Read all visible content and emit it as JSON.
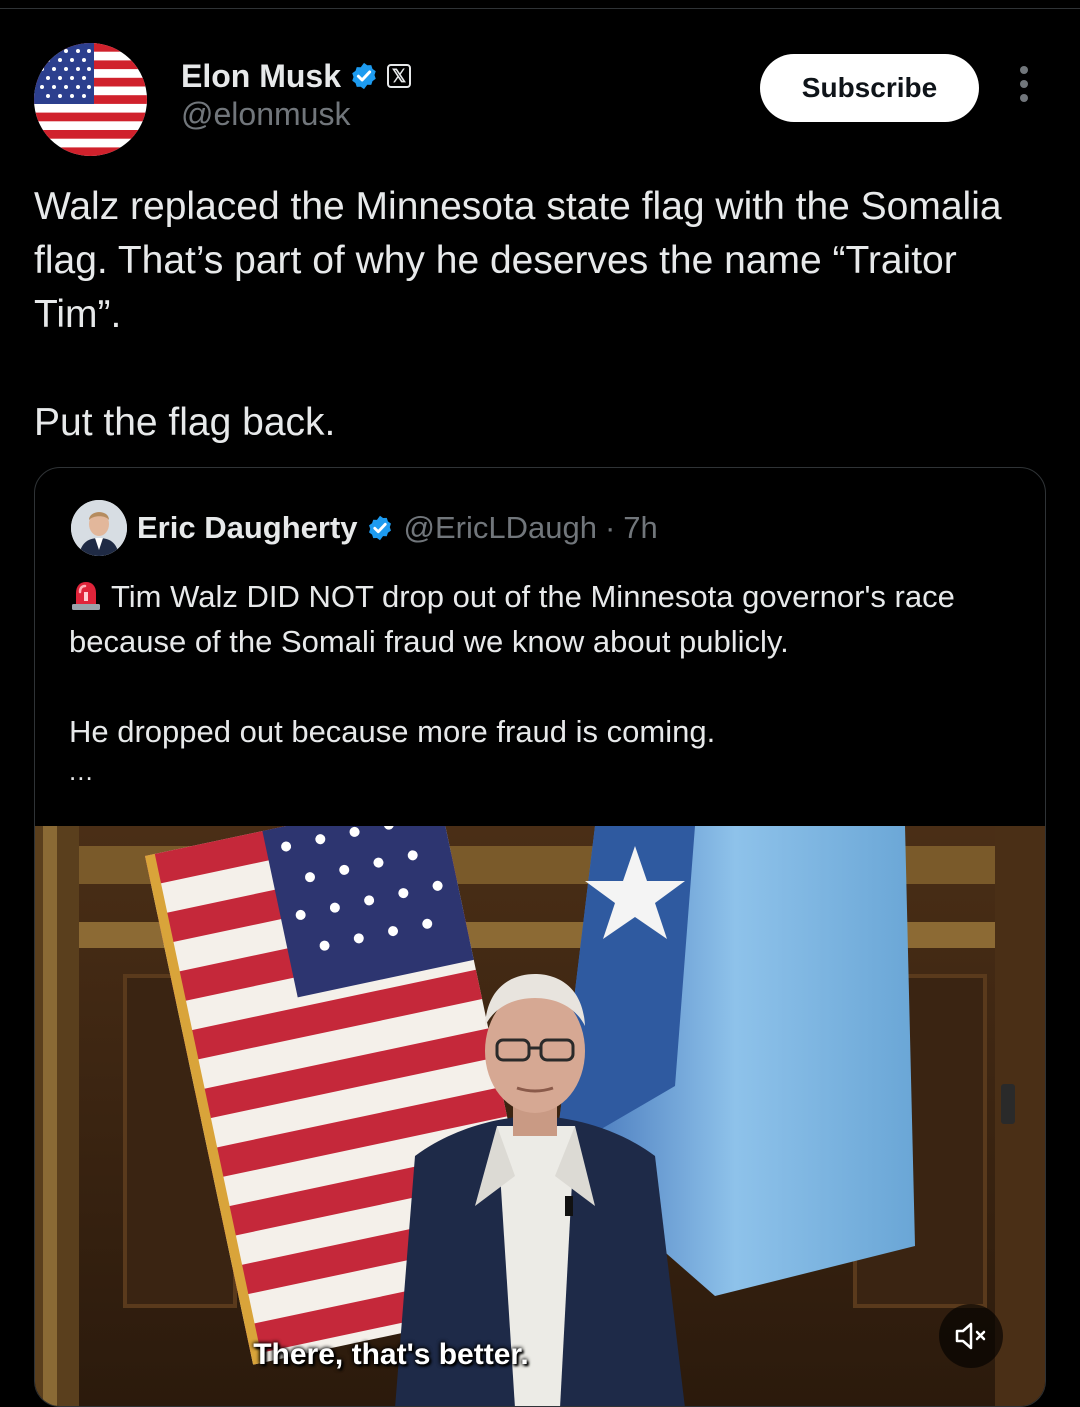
{
  "tweet": {
    "author_name": "Elon Musk",
    "author_handle": "@elonmusk",
    "subscribe_label": "Subscribe",
    "paragraphs": [
      "Walz replaced the Minnesota state flag with the Somalia flag. That’s part of why he deserves the name “Traitor Tim”.",
      "Put the flag back."
    ]
  },
  "quote": {
    "author_name": "Eric Daugherty",
    "author_handle": "@EricLDaugh",
    "separator": "·",
    "time": "7h",
    "paragraphs": [
      "Tim Walz DID NOT drop out of the Minnesota governor's race because of the Somali fraud we know about publicly.",
      "He dropped out because more fraud is coming."
    ],
    "truncation": "...",
    "video": {
      "caption": "There, that's better."
    }
  },
  "colors": {
    "background": "#000000",
    "text": "#e7e9ea",
    "secondary_text": "#71767b",
    "verified": "#1d9bf0",
    "border": "#2f3336"
  },
  "icons": {
    "verified": "verified-badge-icon",
    "affiliate": "x-logo-icon",
    "more": "more-vertical-icon",
    "siren": "siren-emoji-icon",
    "mute": "muted-speaker-icon"
  }
}
